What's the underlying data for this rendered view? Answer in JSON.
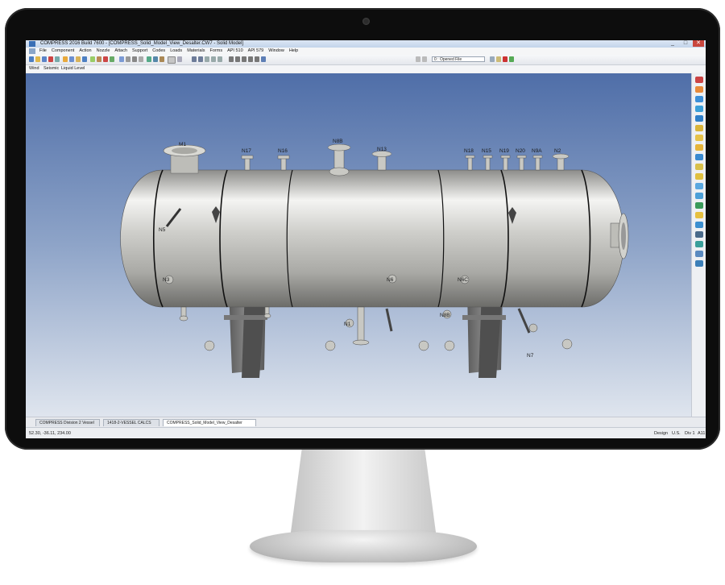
{
  "window": {
    "title": "COMPRESS 2016 Build 7600 - [COMPRESS_Solid_Model_View_Desalter.CW7 - Solid Model]",
    "minimize": "_",
    "maximize": "□",
    "close": "✕"
  },
  "menu": [
    "File",
    "Component",
    "Action",
    "Nozzle",
    "Attach",
    "Support",
    "Codes",
    "Loads",
    "Materials",
    "Forms",
    "API 510",
    "API 579",
    "Window",
    "Help"
  ],
  "toolbar": {
    "open_file_value": "0 : Opened File"
  },
  "subtoolbar": [
    "Wind",
    "Seismic",
    "Liquid Level"
  ],
  "model": {
    "nozzle_labels": [
      "M1",
      "N17",
      "N16",
      "N8B",
      "N13",
      "N18",
      "N15",
      "N19",
      "N20",
      "N9A",
      "N2",
      "N5",
      "N3",
      "N6",
      "N6C",
      "N1",
      "N8B",
      "N7"
    ]
  },
  "tabs": [
    {
      "label": "COMPRESS Division 2 Vessel",
      "active": false
    },
    {
      "label": "1418-2-VESSEL CALCS",
      "active": false
    },
    {
      "label": "COMPRESS_Solid_Model_View_Desalter",
      "active": true
    }
  ],
  "status": {
    "coords": "52.30, -36.11, 234.00",
    "mode": "Design",
    "units": "U.S.",
    "division": "Div 1",
    "code": "A11"
  },
  "colors": {
    "viewport_top": "#4f6ea8",
    "viewport_bottom": "#dfe5ee",
    "vessel": "#c8c8c4",
    "saddle": "#6d6d6d"
  }
}
